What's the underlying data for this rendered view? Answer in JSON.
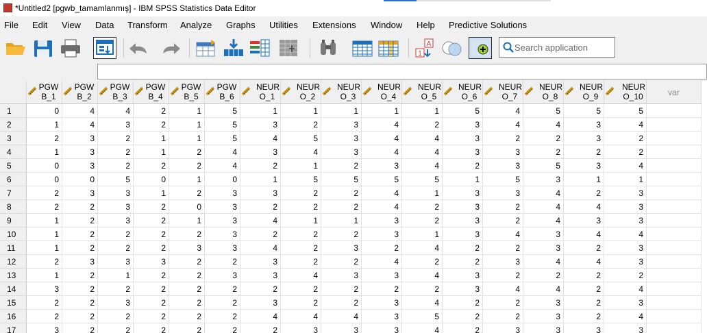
{
  "window": {
    "title": "*Untitled2 [pgwb_tamamlanmış] - IBM SPSS Statistics Data Editor"
  },
  "menu": [
    "File",
    "Edit",
    "View",
    "Data",
    "Transform",
    "Analyze",
    "Graphs",
    "Utilities",
    "Extensions",
    "Window",
    "Help",
    "Predictive Solutions"
  ],
  "toolbar": {
    "icons": [
      "open-folder-icon",
      "save-icon",
      "print-icon",
      "recall-dialog-icon",
      "undo-icon",
      "redo-icon",
      "goto-case-icon",
      "goto-variable-icon",
      "variables-icon",
      "run-descriptives-icon",
      "find-icon",
      "insert-cases-icon",
      "insert-variable-icon",
      "split-file-icon",
      "weight-cases-icon",
      "select-cases-icon",
      "value-labels-icon",
      "use-variable-sets-icon",
      "show-all-variables-icon",
      "spelling-icon"
    ],
    "search_placeholder": "Search application"
  },
  "grid": {
    "columns": [
      {
        "line1": "PGW",
        "line2": "B_1"
      },
      {
        "line1": "PGW",
        "line2": "B_2"
      },
      {
        "line1": "PGW",
        "line2": "B_3"
      },
      {
        "line1": "PGW",
        "line2": "B_4"
      },
      {
        "line1": "PGW",
        "line2": "B_5"
      },
      {
        "line1": "PGW",
        "line2": "B_6"
      },
      {
        "line1": "NEUR",
        "line2": "O_1"
      },
      {
        "line1": "NEUR",
        "line2": "O_2"
      },
      {
        "line1": "NEUR",
        "line2": "O_3"
      },
      {
        "line1": "NEUR",
        "line2": "O_4"
      },
      {
        "line1": "NEUR",
        "line2": "O_5"
      },
      {
        "line1": "NEUR",
        "line2": "O_6"
      },
      {
        "line1": "NEUR",
        "line2": "O_7"
      },
      {
        "line1": "NEUR",
        "line2": "O_8"
      },
      {
        "line1": "NEUR",
        "line2": "O_9"
      },
      {
        "line1": "NEUR",
        "line2": "O_10"
      }
    ],
    "empty_column_label": "var",
    "rows": [
      {
        "n": "1",
        "v": [
          "0",
          "4",
          "4",
          "2",
          "1",
          "5",
          "1",
          "1",
          "1",
          "1",
          "1",
          "5",
          "4",
          "5",
          "5",
          "5"
        ]
      },
      {
        "n": "2",
        "v": [
          "1",
          "4",
          "3",
          "2",
          "1",
          "5",
          "3",
          "2",
          "3",
          "4",
          "2",
          "3",
          "4",
          "4",
          "3",
          "4"
        ]
      },
      {
        "n": "3",
        "v": [
          "2",
          "3",
          "2",
          "1",
          "1",
          "5",
          "4",
          "5",
          "3",
          "4",
          "4",
          "3",
          "2",
          "2",
          "3",
          "2"
        ]
      },
      {
        "n": "4",
        "v": [
          "1",
          "3",
          "2",
          "1",
          "2",
          "4",
          "3",
          "4",
          "3",
          "4",
          "4",
          "3",
          "3",
          "2",
          "2",
          "2"
        ]
      },
      {
        "n": "5",
        "v": [
          "0",
          "3",
          "2",
          "2",
          "2",
          "4",
          "2",
          "1",
          "2",
          "3",
          "4",
          "2",
          "3",
          "5",
          "3",
          "4"
        ]
      },
      {
        "n": "6",
        "v": [
          "0",
          "0",
          "5",
          "0",
          "1",
          "0",
          "1",
          "5",
          "5",
          "5",
          "5",
          "1",
          "5",
          "3",
          "1",
          "1"
        ]
      },
      {
        "n": "7",
        "v": [
          "2",
          "3",
          "3",
          "1",
          "2",
          "3",
          "3",
          "2",
          "2",
          "4",
          "1",
          "3",
          "3",
          "4",
          "2",
          "3"
        ]
      },
      {
        "n": "8",
        "v": [
          "2",
          "2",
          "3",
          "2",
          "0",
          "3",
          "2",
          "2",
          "2",
          "4",
          "2",
          "3",
          "2",
          "4",
          "4",
          "3"
        ]
      },
      {
        "n": "9",
        "v": [
          "1",
          "2",
          "3",
          "2",
          "1",
          "3",
          "4",
          "1",
          "1",
          "3",
          "2",
          "3",
          "2",
          "4",
          "3",
          "3"
        ]
      },
      {
        "n": "10",
        "v": [
          "1",
          "2",
          "2",
          "2",
          "2",
          "3",
          "2",
          "2",
          "2",
          "3",
          "1",
          "3",
          "4",
          "3",
          "4",
          "4"
        ]
      },
      {
        "n": "11",
        "v": [
          "1",
          "2",
          "2",
          "2",
          "3",
          "3",
          "4",
          "2",
          "3",
          "2",
          "4",
          "2",
          "2",
          "3",
          "2",
          "3"
        ]
      },
      {
        "n": "12",
        "v": [
          "2",
          "3",
          "3",
          "3",
          "2",
          "2",
          "3",
          "2",
          "2",
          "4",
          "2",
          "2",
          "3",
          "4",
          "4",
          "3"
        ]
      },
      {
        "n": "13",
        "v": [
          "1",
          "2",
          "1",
          "2",
          "2",
          "3",
          "3",
          "4",
          "3",
          "3",
          "4",
          "3",
          "2",
          "2",
          "2",
          "2"
        ]
      },
      {
        "n": "14",
        "v": [
          "3",
          "2",
          "2",
          "2",
          "2",
          "2",
          "2",
          "2",
          "2",
          "2",
          "2",
          "3",
          "4",
          "4",
          "2",
          "4"
        ]
      },
      {
        "n": "15",
        "v": [
          "2",
          "2",
          "3",
          "2",
          "2",
          "2",
          "3",
          "2",
          "2",
          "3",
          "4",
          "2",
          "2",
          "3",
          "2",
          "3"
        ]
      },
      {
        "n": "16",
        "v": [
          "2",
          "2",
          "2",
          "2",
          "2",
          "2",
          "4",
          "4",
          "4",
          "3",
          "5",
          "2",
          "2",
          "3",
          "2",
          "4"
        ]
      },
      {
        "n": "17",
        "v": [
          "3",
          "2",
          "2",
          "2",
          "2",
          "2",
          "2",
          "3",
          "3",
          "3",
          "4",
          "2",
          "3",
          "3",
          "3",
          "3"
        ]
      }
    ]
  }
}
